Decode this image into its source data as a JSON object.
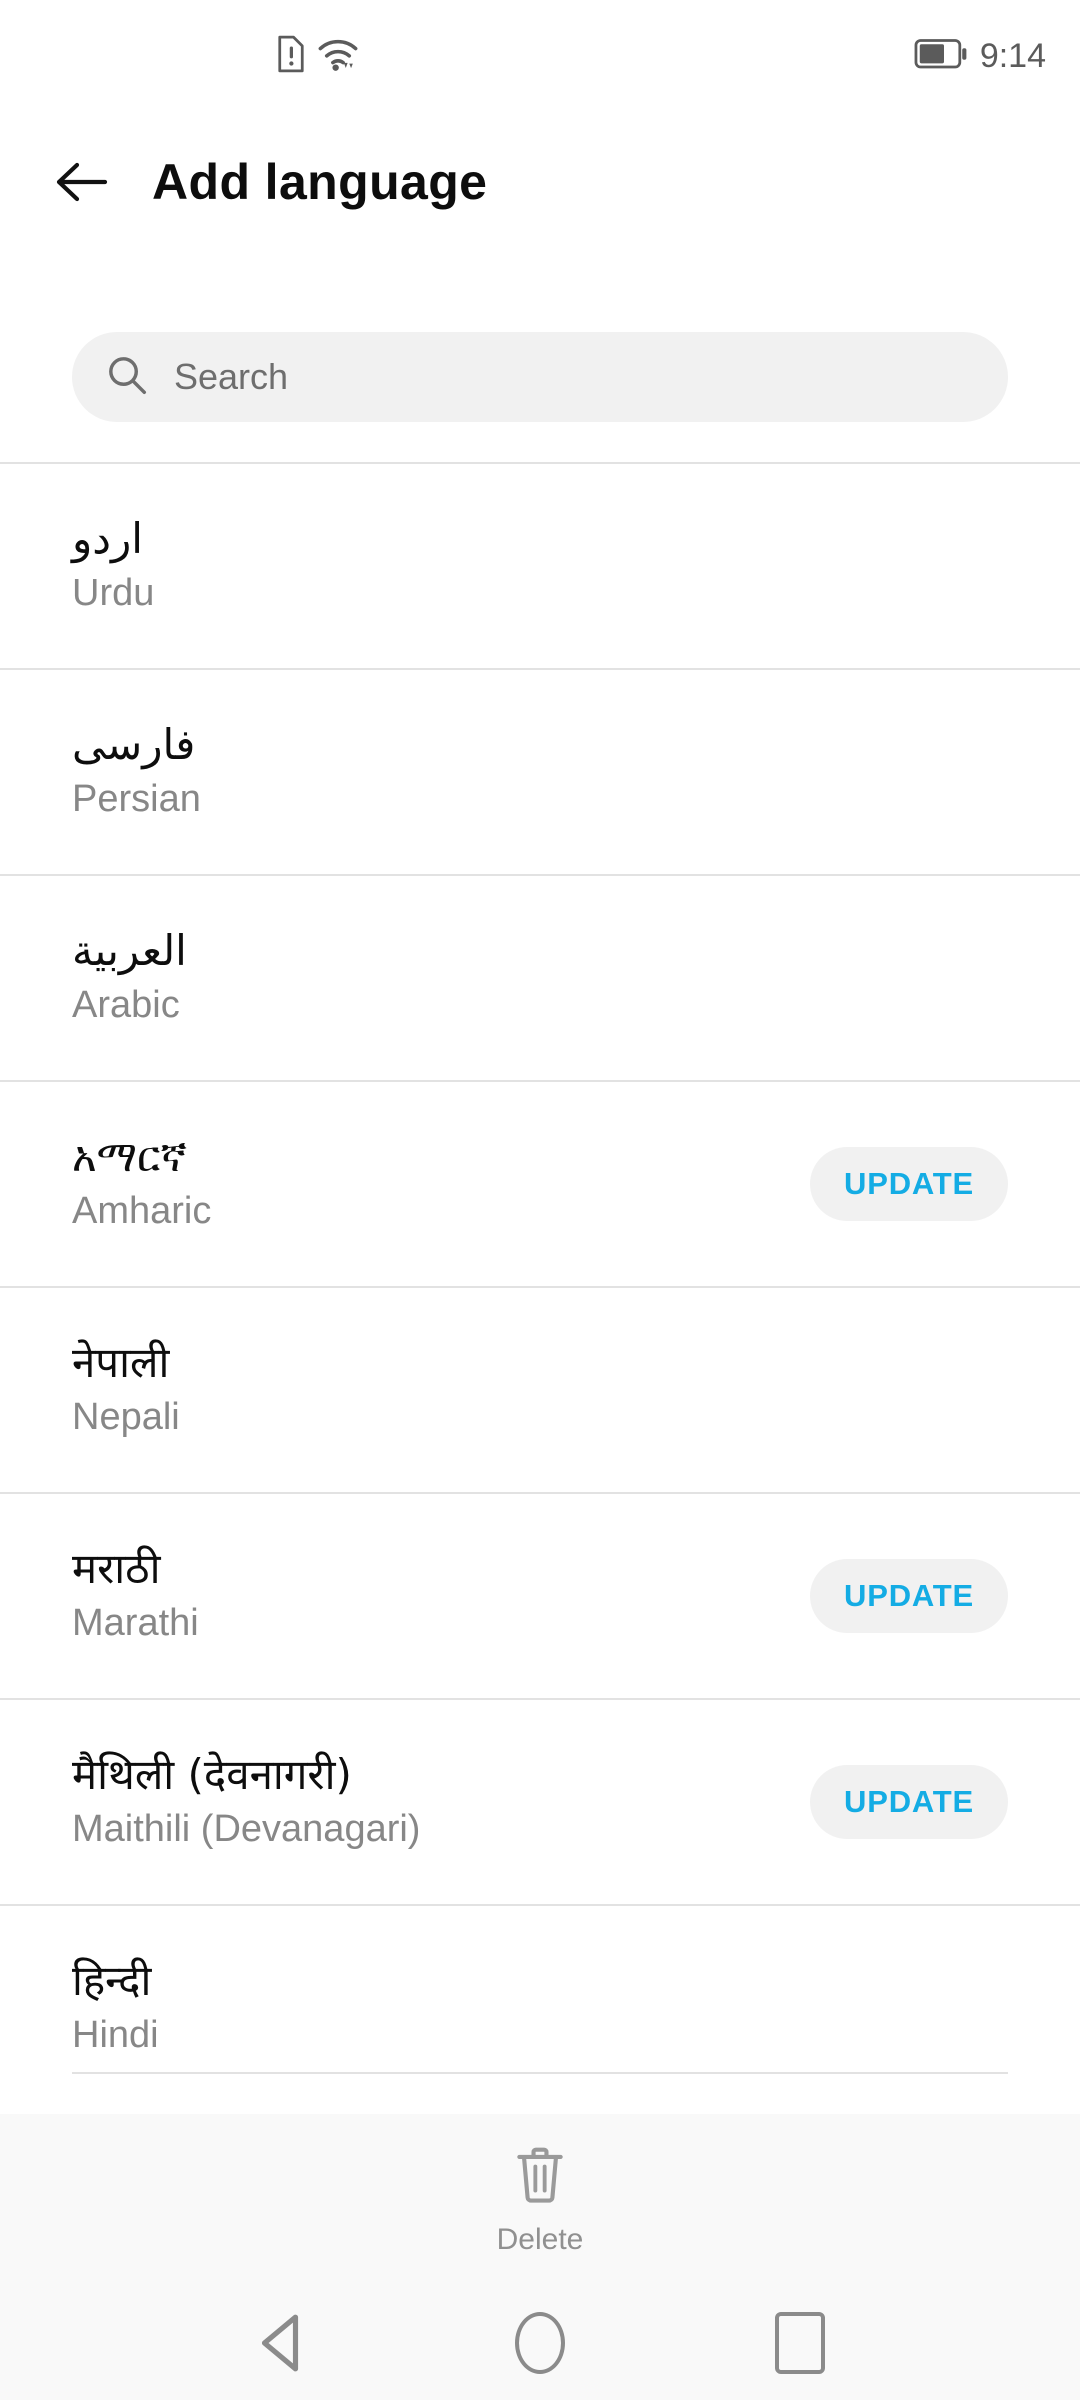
{
  "status_bar": {
    "time": "9:14",
    "icons": [
      "sim-card-alert-icon",
      "wifi-icon",
      "battery-icon"
    ],
    "battery_level_percent": 60
  },
  "header": {
    "back_label": "back-arrow",
    "title": "Add language"
  },
  "search": {
    "placeholder": "Search",
    "value": "",
    "icon": "search-icon"
  },
  "languages": [
    {
      "native": "اردو",
      "english": "Urdu",
      "action": null
    },
    {
      "native": "فارسی",
      "english": "Persian",
      "action": null
    },
    {
      "native": "العربية",
      "english": "Arabic",
      "action": null
    },
    {
      "native": "አማርኛ",
      "english": "Amharic",
      "action": "UPDATE"
    },
    {
      "native": "नेपाली",
      "english": "Nepali",
      "action": null
    },
    {
      "native": "मराठी",
      "english": "Marathi",
      "action": "UPDATE"
    },
    {
      "native": "मैथिली (देवनागरी)",
      "english": "Maithili (Devanagari)",
      "action": "UPDATE"
    },
    {
      "native": "हिन्दी",
      "english": "Hindi",
      "action": null
    }
  ],
  "bottom_bar": {
    "delete_label": "Delete",
    "delete_icon": "trash-icon"
  },
  "nav_bar": {
    "back": "back-triangle-icon",
    "home": "home-circle-icon",
    "recents": "recents-square-icon"
  },
  "colors": {
    "accent": "#14ace4",
    "primary_text": "#0d0d0d",
    "secondary_text": "#878787",
    "divider": "#e2e2e2",
    "chip_bg": "#f1f1f1",
    "bar_bg": "#f9f9f9"
  }
}
